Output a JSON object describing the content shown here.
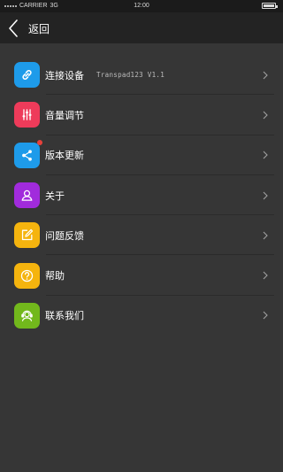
{
  "status_bar": {
    "carrier": "CARRIER",
    "network": "3G",
    "time": "12:00"
  },
  "nav": {
    "back_label": "返回"
  },
  "colors": {
    "background": "#363636",
    "nav_bar": "#232323",
    "status_bar": "#1b1b1b",
    "badge": "#e8413b"
  },
  "menu": {
    "items": [
      {
        "label": "连接设备",
        "value": "Transpad123 V1.1",
        "icon": "link-icon",
        "color": "#1e9bea"
      },
      {
        "label": "音量调节",
        "icon": "sliders-icon",
        "color": "#ee3b5a"
      },
      {
        "label": "版本更新",
        "icon": "share-icon",
        "color": "#1e9bea",
        "badge": true
      },
      {
        "label": "关于",
        "icon": "user-icon",
        "color": "#a12bdc"
      },
      {
        "label": "问题反馈",
        "icon": "edit-icon",
        "color": "#f5b40e"
      },
      {
        "label": "帮助",
        "icon": "help-icon",
        "color": "#f5b40e"
      },
      {
        "label": "联系我们",
        "icon": "headset-icon",
        "color": "#72b81c"
      }
    ]
  }
}
